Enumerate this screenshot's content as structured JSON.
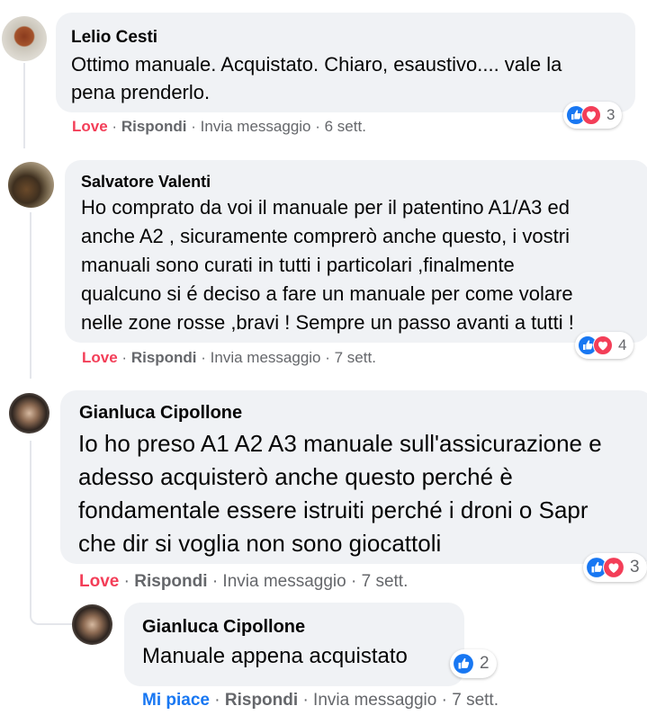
{
  "comments": [
    {
      "author": "Lelio Cesti",
      "text": "Ottimo manuale. Acquistato. Chiaro, esaustivo.... vale la\npena prenderlo.",
      "actions": {
        "primary": "Love",
        "reply": "Rispondi",
        "message": "Invia messaggio",
        "age": "6 sett."
      },
      "reactions": {
        "types": [
          "like-icon",
          "love-icon"
        ],
        "count": "3"
      }
    },
    {
      "author": "Salvatore Valenti",
      "text": "Ho comprato da voi il manuale per il patentino A1/A3 ed\nanche A2 , sicuramente comprerò anche questo, i vostri\nmanuali sono curati in tutti i particolari ,finalmente\nqualcuno si é deciso a fare un manuale per come volare\nnelle zone rosse ,bravi ! Sempre un passo avanti a tutti !",
      "actions": {
        "primary": "Love",
        "reply": "Rispondi",
        "message": "Invia messaggio",
        "age": "7 sett."
      },
      "reactions": {
        "types": [
          "like-icon",
          "love-icon"
        ],
        "count": "4"
      }
    },
    {
      "author": "Gianluca Cipollone",
      "text": "Io ho preso A1 A2 A3 manuale sull'assicurazione e\nadesso acquisterò anche questo perché è\nfondamentale essere istruiti perché i droni o Sapr\nche dir si voglia non sono giocattoli",
      "actions": {
        "primary": "Love",
        "reply": "Rispondi",
        "message": "Invia messaggio",
        "age": "7 sett."
      },
      "reactions": {
        "types": [
          "like-icon",
          "love-icon"
        ],
        "count": "3"
      },
      "reply": {
        "author": "Gianluca Cipollone",
        "text": "Manuale appena acquistato",
        "actions": {
          "primary": "Mi piace",
          "reply": "Rispondi",
          "message": "Invia messaggio",
          "age": "7 sett."
        },
        "reactions": {
          "types": [
            "like-icon"
          ],
          "count": "2"
        }
      }
    }
  ],
  "separator": "·",
  "colors": {
    "love": "#f33e58",
    "like": "#1877f2",
    "bubble": "#f0f2f5",
    "muted": "#65676b"
  }
}
